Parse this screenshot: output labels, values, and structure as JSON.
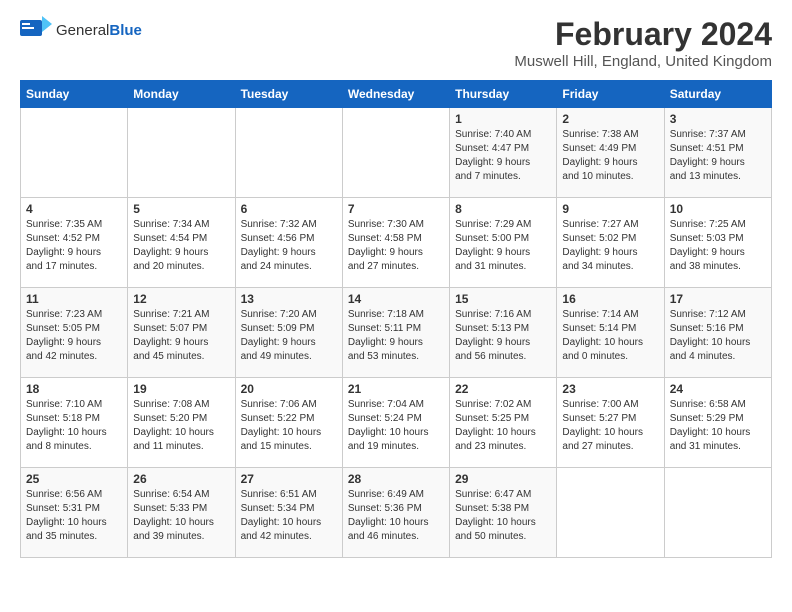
{
  "header": {
    "logo": {
      "general": "General",
      "blue": "Blue"
    },
    "title": "February 2024",
    "subtitle": "Muswell Hill, England, United Kingdom"
  },
  "weekdays": [
    "Sunday",
    "Monday",
    "Tuesday",
    "Wednesday",
    "Thursday",
    "Friday",
    "Saturday"
  ],
  "weeks": [
    [
      {
        "day": "",
        "info": ""
      },
      {
        "day": "",
        "info": ""
      },
      {
        "day": "",
        "info": ""
      },
      {
        "day": "",
        "info": ""
      },
      {
        "day": "1",
        "info": "Sunrise: 7:40 AM\nSunset: 4:47 PM\nDaylight: 9 hours\nand 7 minutes."
      },
      {
        "day": "2",
        "info": "Sunrise: 7:38 AM\nSunset: 4:49 PM\nDaylight: 9 hours\nand 10 minutes."
      },
      {
        "day": "3",
        "info": "Sunrise: 7:37 AM\nSunset: 4:51 PM\nDaylight: 9 hours\nand 13 minutes."
      }
    ],
    [
      {
        "day": "4",
        "info": "Sunrise: 7:35 AM\nSunset: 4:52 PM\nDaylight: 9 hours\nand 17 minutes."
      },
      {
        "day": "5",
        "info": "Sunrise: 7:34 AM\nSunset: 4:54 PM\nDaylight: 9 hours\nand 20 minutes."
      },
      {
        "day": "6",
        "info": "Sunrise: 7:32 AM\nSunset: 4:56 PM\nDaylight: 9 hours\nand 24 minutes."
      },
      {
        "day": "7",
        "info": "Sunrise: 7:30 AM\nSunset: 4:58 PM\nDaylight: 9 hours\nand 27 minutes."
      },
      {
        "day": "8",
        "info": "Sunrise: 7:29 AM\nSunset: 5:00 PM\nDaylight: 9 hours\nand 31 minutes."
      },
      {
        "day": "9",
        "info": "Sunrise: 7:27 AM\nSunset: 5:02 PM\nDaylight: 9 hours\nand 34 minutes."
      },
      {
        "day": "10",
        "info": "Sunrise: 7:25 AM\nSunset: 5:03 PM\nDaylight: 9 hours\nand 38 minutes."
      }
    ],
    [
      {
        "day": "11",
        "info": "Sunrise: 7:23 AM\nSunset: 5:05 PM\nDaylight: 9 hours\nand 42 minutes."
      },
      {
        "day": "12",
        "info": "Sunrise: 7:21 AM\nSunset: 5:07 PM\nDaylight: 9 hours\nand 45 minutes."
      },
      {
        "day": "13",
        "info": "Sunrise: 7:20 AM\nSunset: 5:09 PM\nDaylight: 9 hours\nand 49 minutes."
      },
      {
        "day": "14",
        "info": "Sunrise: 7:18 AM\nSunset: 5:11 PM\nDaylight: 9 hours\nand 53 minutes."
      },
      {
        "day": "15",
        "info": "Sunrise: 7:16 AM\nSunset: 5:13 PM\nDaylight: 9 hours\nand 56 minutes."
      },
      {
        "day": "16",
        "info": "Sunrise: 7:14 AM\nSunset: 5:14 PM\nDaylight: 10 hours\nand 0 minutes."
      },
      {
        "day": "17",
        "info": "Sunrise: 7:12 AM\nSunset: 5:16 PM\nDaylight: 10 hours\nand 4 minutes."
      }
    ],
    [
      {
        "day": "18",
        "info": "Sunrise: 7:10 AM\nSunset: 5:18 PM\nDaylight: 10 hours\nand 8 minutes."
      },
      {
        "day": "19",
        "info": "Sunrise: 7:08 AM\nSunset: 5:20 PM\nDaylight: 10 hours\nand 11 minutes."
      },
      {
        "day": "20",
        "info": "Sunrise: 7:06 AM\nSunset: 5:22 PM\nDaylight: 10 hours\nand 15 minutes."
      },
      {
        "day": "21",
        "info": "Sunrise: 7:04 AM\nSunset: 5:24 PM\nDaylight: 10 hours\nand 19 minutes."
      },
      {
        "day": "22",
        "info": "Sunrise: 7:02 AM\nSunset: 5:25 PM\nDaylight: 10 hours\nand 23 minutes."
      },
      {
        "day": "23",
        "info": "Sunrise: 7:00 AM\nSunset: 5:27 PM\nDaylight: 10 hours\nand 27 minutes."
      },
      {
        "day": "24",
        "info": "Sunrise: 6:58 AM\nSunset: 5:29 PM\nDaylight: 10 hours\nand 31 minutes."
      }
    ],
    [
      {
        "day": "25",
        "info": "Sunrise: 6:56 AM\nSunset: 5:31 PM\nDaylight: 10 hours\nand 35 minutes."
      },
      {
        "day": "26",
        "info": "Sunrise: 6:54 AM\nSunset: 5:33 PM\nDaylight: 10 hours\nand 39 minutes."
      },
      {
        "day": "27",
        "info": "Sunrise: 6:51 AM\nSunset: 5:34 PM\nDaylight: 10 hours\nand 42 minutes."
      },
      {
        "day": "28",
        "info": "Sunrise: 6:49 AM\nSunset: 5:36 PM\nDaylight: 10 hours\nand 46 minutes."
      },
      {
        "day": "29",
        "info": "Sunrise: 6:47 AM\nSunset: 5:38 PM\nDaylight: 10 hours\nand 50 minutes."
      },
      {
        "day": "",
        "info": ""
      },
      {
        "day": "",
        "info": ""
      }
    ]
  ]
}
